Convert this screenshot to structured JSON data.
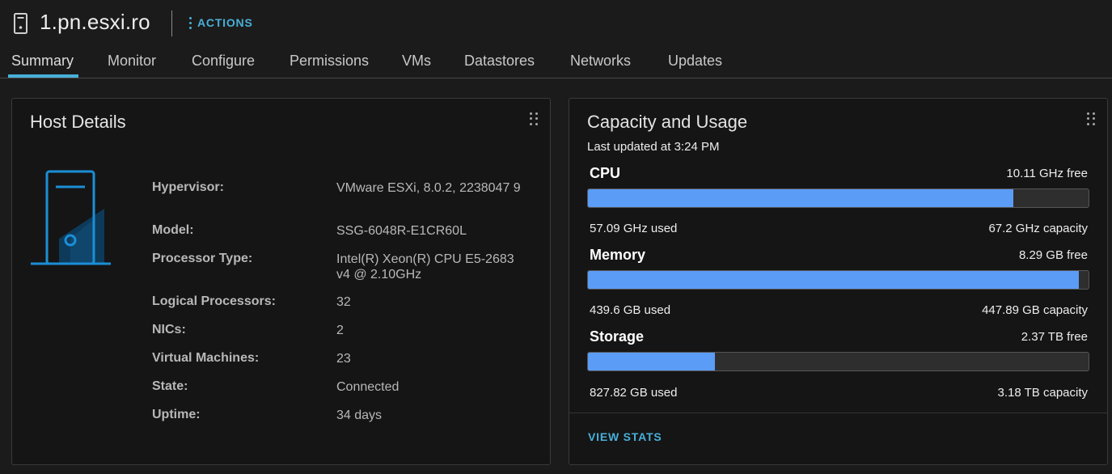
{
  "header": {
    "title": "1.pn.esxi.ro",
    "actions_label": "ACTIONS",
    "icon": "host-server-icon"
  },
  "tabs": [
    {
      "label": "Summary",
      "active": true
    },
    {
      "label": "Monitor"
    },
    {
      "label": "Configure"
    },
    {
      "label": "Permissions"
    },
    {
      "label": "VMs"
    },
    {
      "label": "Datastores"
    },
    {
      "label": "Networks"
    },
    {
      "label": "Updates"
    }
  ],
  "host_details": {
    "title": "Host Details",
    "rows": [
      {
        "label": "Hypervisor:",
        "value": "VMware ESXi, 8.0.2, 2238047 9"
      },
      {
        "label": "Model:",
        "value": "SSG-6048R-E1CR60L"
      },
      {
        "label": "Processor Type:",
        "value": "Intel(R) Xeon(R) CPU E5-2683 v4 @ 2.10GHz"
      },
      {
        "label": "Logical Processors:",
        "value": "32"
      },
      {
        "label": "NICs:",
        "value": "2"
      },
      {
        "label": "Virtual Machines:",
        "value": "23"
      },
      {
        "label": "State:",
        "value": "Connected"
      },
      {
        "label": "Uptime:",
        "value": "34 days"
      }
    ]
  },
  "capacity": {
    "title": "Capacity and Usage",
    "last_updated": "Last updated at 3:24 PM",
    "metrics": [
      {
        "name": "CPU",
        "free": "10.11 GHz free",
        "used": "57.09 GHz used",
        "capacity": "67.2 GHz capacity",
        "fraction": 0.85
      },
      {
        "name": "Memory",
        "free": "8.29 GB free",
        "used": "439.6 GB used",
        "capacity": "447.89 GB capacity",
        "fraction": 0.981
      },
      {
        "name": "Storage",
        "free": "2.37 TB free",
        "used": "827.82 GB used",
        "capacity": "3.18 TB capacity",
        "fraction": 0.254
      }
    ],
    "view_stats": "VIEW STATS"
  },
  "colors": {
    "accent": "#49afd9",
    "bar_fill": "#5b9cf6",
    "background": "#1b1b1b",
    "card": "#151515"
  }
}
